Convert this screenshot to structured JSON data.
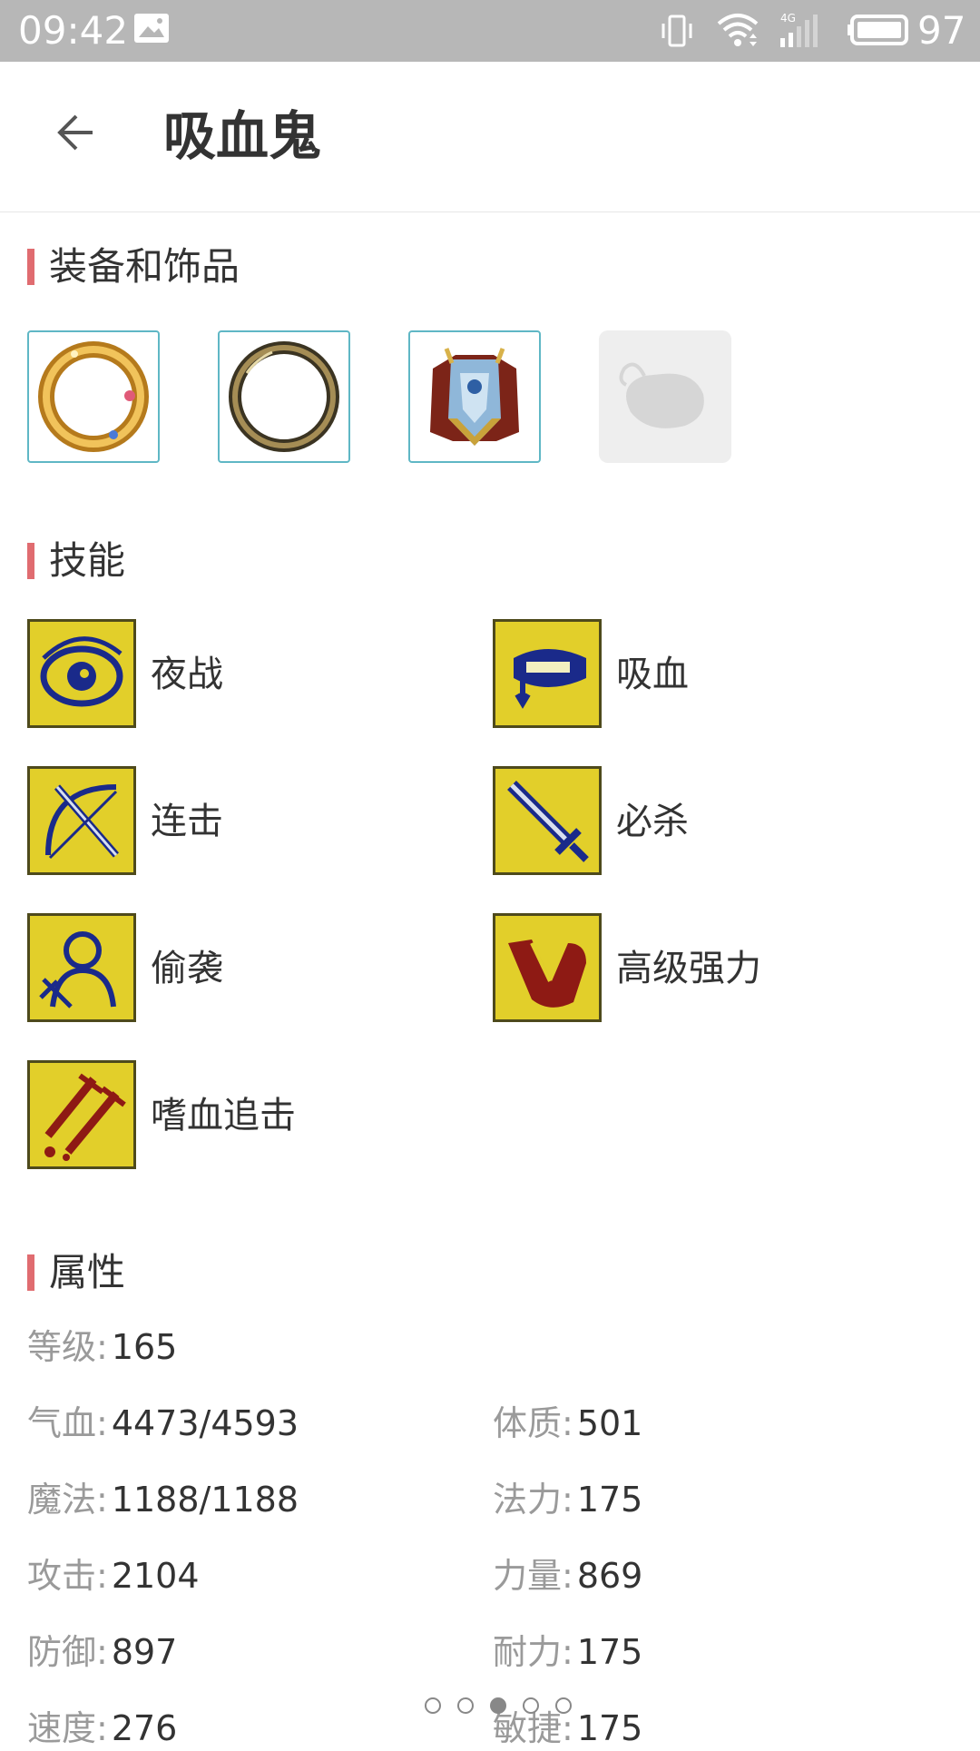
{
  "status_bar": {
    "time": "09:42",
    "battery": "97",
    "icons": [
      "picture-icon",
      "vibrate-icon",
      "wifi-icon",
      "signal-4g-icon",
      "battery-icon"
    ]
  },
  "header": {
    "title": "吸血鬼",
    "back_icon": "arrow-left-icon"
  },
  "equipment": {
    "title": "装备和饰品",
    "slots": [
      {
        "icon": "gold-ring-icon"
      },
      {
        "icon": "bronze-ring-icon"
      },
      {
        "icon": "armor-icon"
      },
      {
        "icon": "empty-slot-icon"
      }
    ]
  },
  "skills": {
    "title": "技能",
    "items": [
      {
        "label": "夜战",
        "icon": "eye-icon"
      },
      {
        "label": "吸血",
        "icon": "fangs-icon"
      },
      {
        "label": "连击",
        "icon": "bow-sword-icon"
      },
      {
        "label": "必杀",
        "icon": "sword-icon"
      },
      {
        "label": "偷袭",
        "icon": "figure-icon"
      },
      {
        "label": "高级强力",
        "icon": "arm-icon"
      },
      {
        "label": "嗜血追击",
        "icon": "blood-swords-icon"
      }
    ]
  },
  "attributes": {
    "title": "属性",
    "level": {
      "label": "等级:",
      "value": "165"
    },
    "left": [
      {
        "label": "气血:",
        "value": "4473/4593"
      },
      {
        "label": "魔法:",
        "value": "1188/1188"
      },
      {
        "label": "攻击:",
        "value": "2104"
      },
      {
        "label": "防御:",
        "value": "897"
      },
      {
        "label": "速度:",
        "value": "276"
      }
    ],
    "right": [
      {
        "label": "体质:",
        "value": "501"
      },
      {
        "label": "法力:",
        "value": "175"
      },
      {
        "label": "力量:",
        "value": "869"
      },
      {
        "label": "耐力:",
        "value": "175"
      },
      {
        "label": "敏捷:",
        "value": "175"
      }
    ]
  },
  "pager": {
    "total_pages": 5,
    "current_page": 3
  },
  "colors": {
    "status_bar": "#b7b7b7",
    "section_accent": "#e06c70",
    "slot_border": "#5fb7c5",
    "skill_gold": "#e6d22a",
    "label_gray": "#9a9a9a"
  }
}
